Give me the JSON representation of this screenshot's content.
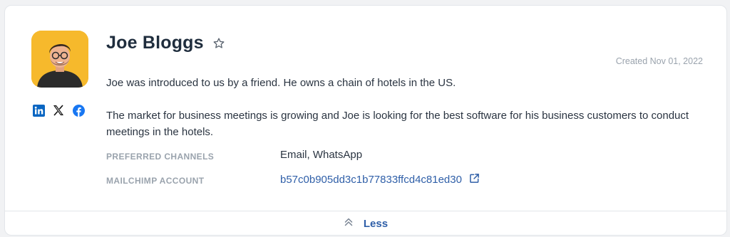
{
  "contact": {
    "name": "Joe Bloggs",
    "created": "Created Nov 01, 2022",
    "description": [
      "Joe was introduced to us by a friend. He owns a chain of hotels in the US.",
      "The market for business meetings is growing and Joe is looking for the best software for his business customers to conduct meetings in the hotels."
    ],
    "fields": {
      "preferred_channels_label": "PREFERRED CHANNELS",
      "preferred_channels_value": "Email, WhatsApp",
      "mailchimp_label": "MAILCHIMP ACCOUNT",
      "mailchimp_value": "b57c0b905dd3c1b77833ffcd4c81ed30"
    }
  },
  "socials": [
    "linkedin-icon",
    "x-icon",
    "facebook-icon"
  ],
  "footer": {
    "less_label": "Less"
  },
  "colors": {
    "accent": "#2f5fa8",
    "facebook": "#1877f2",
    "linkedin": "#0a66c2",
    "avatar_bg": "#f6b92c"
  }
}
